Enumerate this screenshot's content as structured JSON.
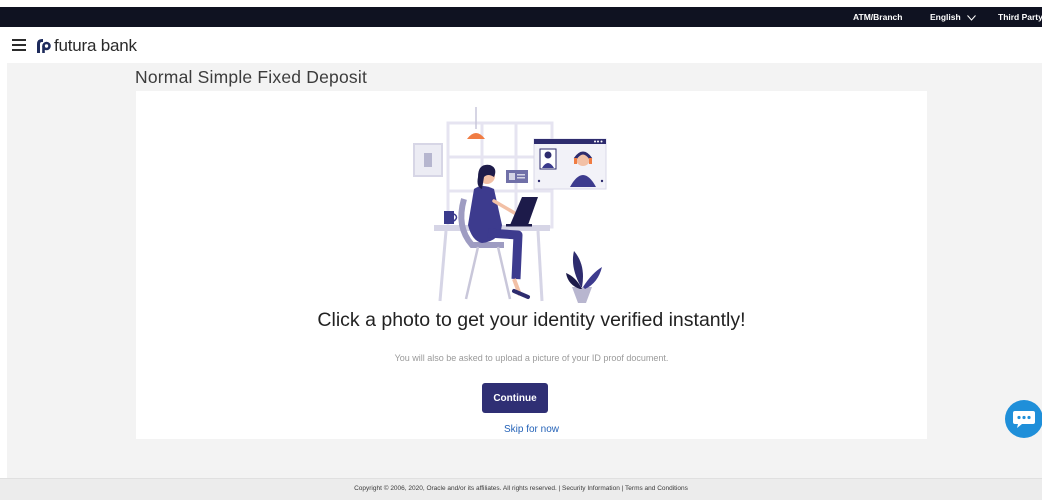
{
  "topbar": {
    "atm_branch": "ATM/Branch",
    "language": "English",
    "third_party": "Third Party"
  },
  "header": {
    "logo_text": "futura bank"
  },
  "page": {
    "title": "Normal Simple Fixed Deposit"
  },
  "card": {
    "headline": "Click a photo to get your identity verified instantly!",
    "subtext": "You will also be asked to upload a picture of your ID proof document.",
    "continue_label": "Continue",
    "skip_label": "Skip for now"
  },
  "footer": {
    "text": "Copyright © 2006, 2020, Oracle and/or its affiliates. All rights reserved. | Security Information | Terms and Conditions"
  },
  "colors": {
    "topbar_bg": "#0f1221",
    "primary_button": "#2f2f74",
    "link": "#2563b8",
    "chat_button": "#1f8fd9",
    "accent_orange": "#f07c43"
  },
  "icons": {
    "menu": "hamburger-icon",
    "language_dropdown": "chevron-down-icon",
    "logo": "futura-bank-logo-icon",
    "chat": "chat-bubble-icon"
  }
}
